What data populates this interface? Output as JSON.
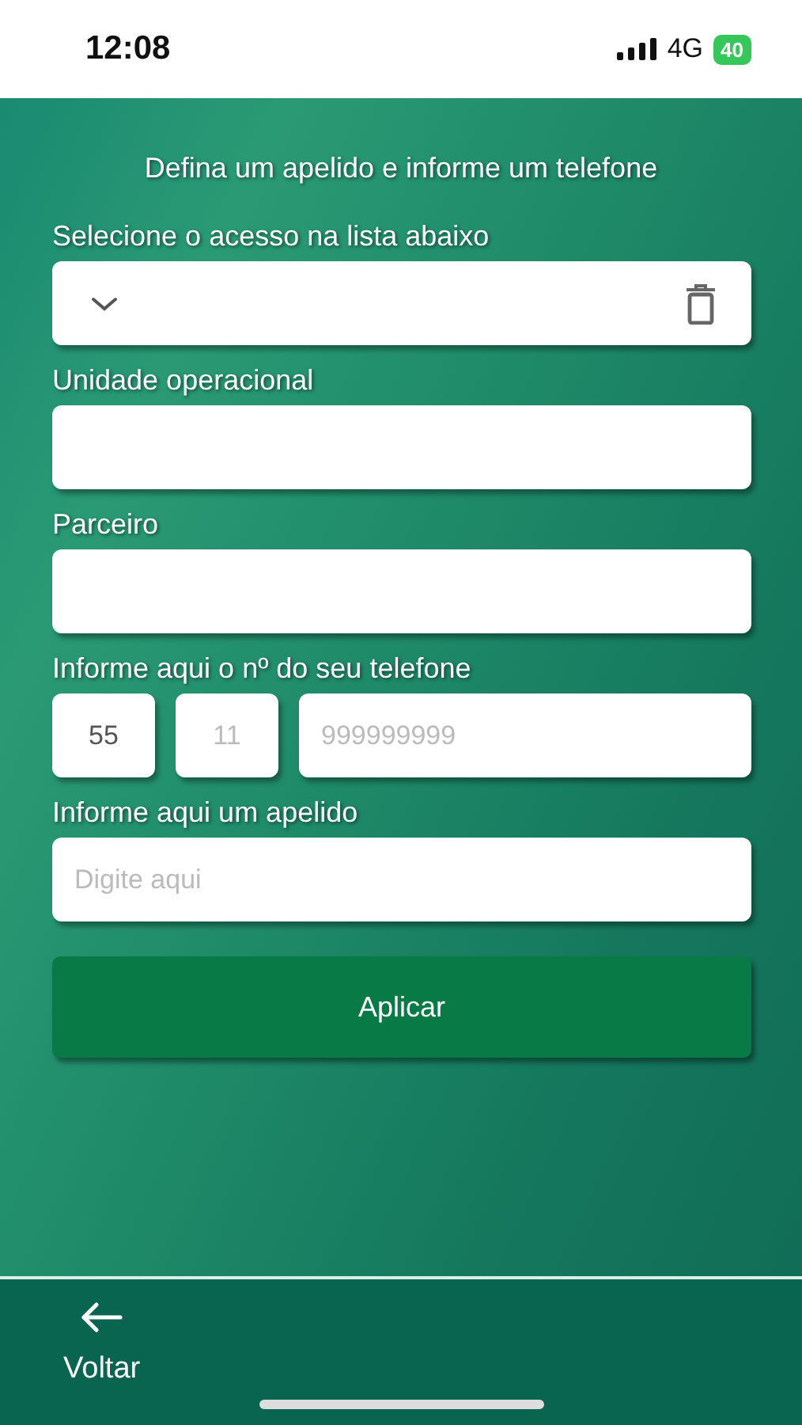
{
  "status_bar": {
    "time": "12:08",
    "network": "4G",
    "battery": "40"
  },
  "title": "Defina um apelido e informe um telefone",
  "access_select": {
    "label": "Selecione o acesso na lista abaixo"
  },
  "unit_field": {
    "label": "Unidade operacional"
  },
  "partner_field": {
    "label": "Parceiro"
  },
  "phone": {
    "label": "Informe aqui o nº do seu telefone",
    "country_code": {
      "value": "55"
    },
    "area_code": {
      "placeholder": "11"
    },
    "number": {
      "placeholder": "999999999"
    }
  },
  "nickname_field": {
    "label": "Informe aqui um apelido",
    "placeholder": "Digite aqui"
  },
  "apply_button": "Aplicar",
  "bottom_nav": {
    "back": "Voltar"
  }
}
